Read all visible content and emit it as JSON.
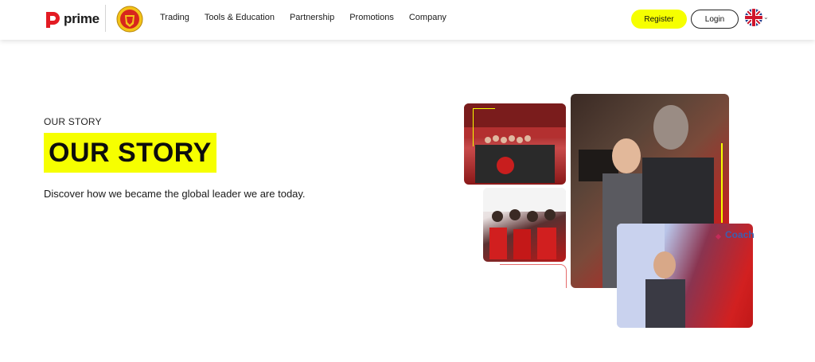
{
  "header": {
    "logo_text": "prime",
    "nav": [
      "Trading",
      "Tools & Education",
      "Partnership",
      "Promotions",
      "Company"
    ],
    "register_label": "Register",
    "login_label": "Login",
    "language_icon": "uk-flag-icon"
  },
  "hero": {
    "eyebrow": "OUR STORY",
    "title": "OUR STORY",
    "subtitle": "Discover how we became the global leader we are today."
  },
  "collage": {
    "coach_label": "Coach"
  },
  "colors": {
    "accent_yellow": "#f6ff00",
    "brand_red": "#e31b23"
  }
}
